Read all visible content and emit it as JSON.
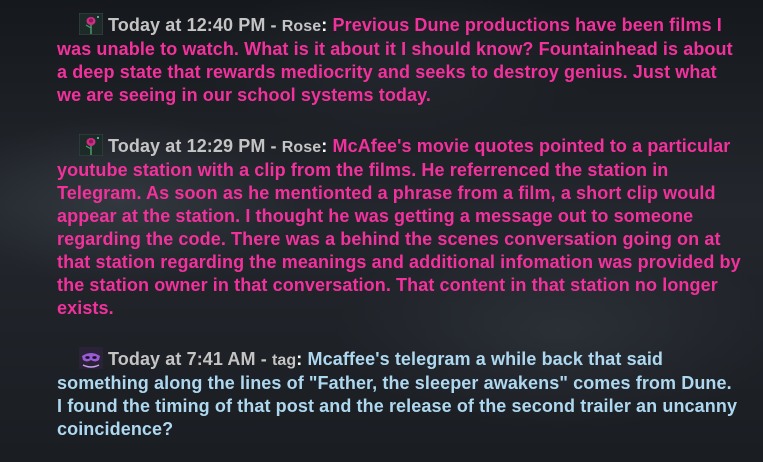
{
  "colors": {
    "rose_message": "#f2319c",
    "tag_message": "#aed8f0",
    "meta_text": "#c4c4c4"
  },
  "messages": [
    {
      "avatar_icon": "rose-avatar-icon",
      "timestamp": "Today at 12:40 PM",
      "separator": "-",
      "username": "Rose",
      "colon": ":",
      "text": "Previous Dune productions have been films I was unable to watch. What is it about it I should know? Fountainhead is about a deep state that rewards mediocrity and seeks to destroy genius. Just what we are seeing in our school systems today."
    },
    {
      "avatar_icon": "rose-avatar-icon",
      "timestamp": "Today at 12:29 PM",
      "separator": "-",
      "username": "Rose",
      "colon": ":",
      "text": "McAfee's movie quotes pointed to a particular youtube station with a clip from the films. He referrenced the station in Telegram. As soon as he mentionted a phrase from a film, a short clip would appear at the station. I thought he was getting a message out to someone regarding the code. There was a behind the scenes conversation going on at that station regarding the meanings and additional infomation was provided by the station owner in that conversation. That content in that station no longer exists."
    },
    {
      "avatar_icon": "purple-mask-avatar-icon",
      "timestamp": "Today at 7:41 AM",
      "separator": "-",
      "username": "tag",
      "colon": ":",
      "text": "Mcaffee's telegram a while back that said something along the lines of \"Father, the sleeper awakens\" comes from Dune. I found the timing of that post and the release of the second trailer an uncanny coincidence?"
    }
  ]
}
